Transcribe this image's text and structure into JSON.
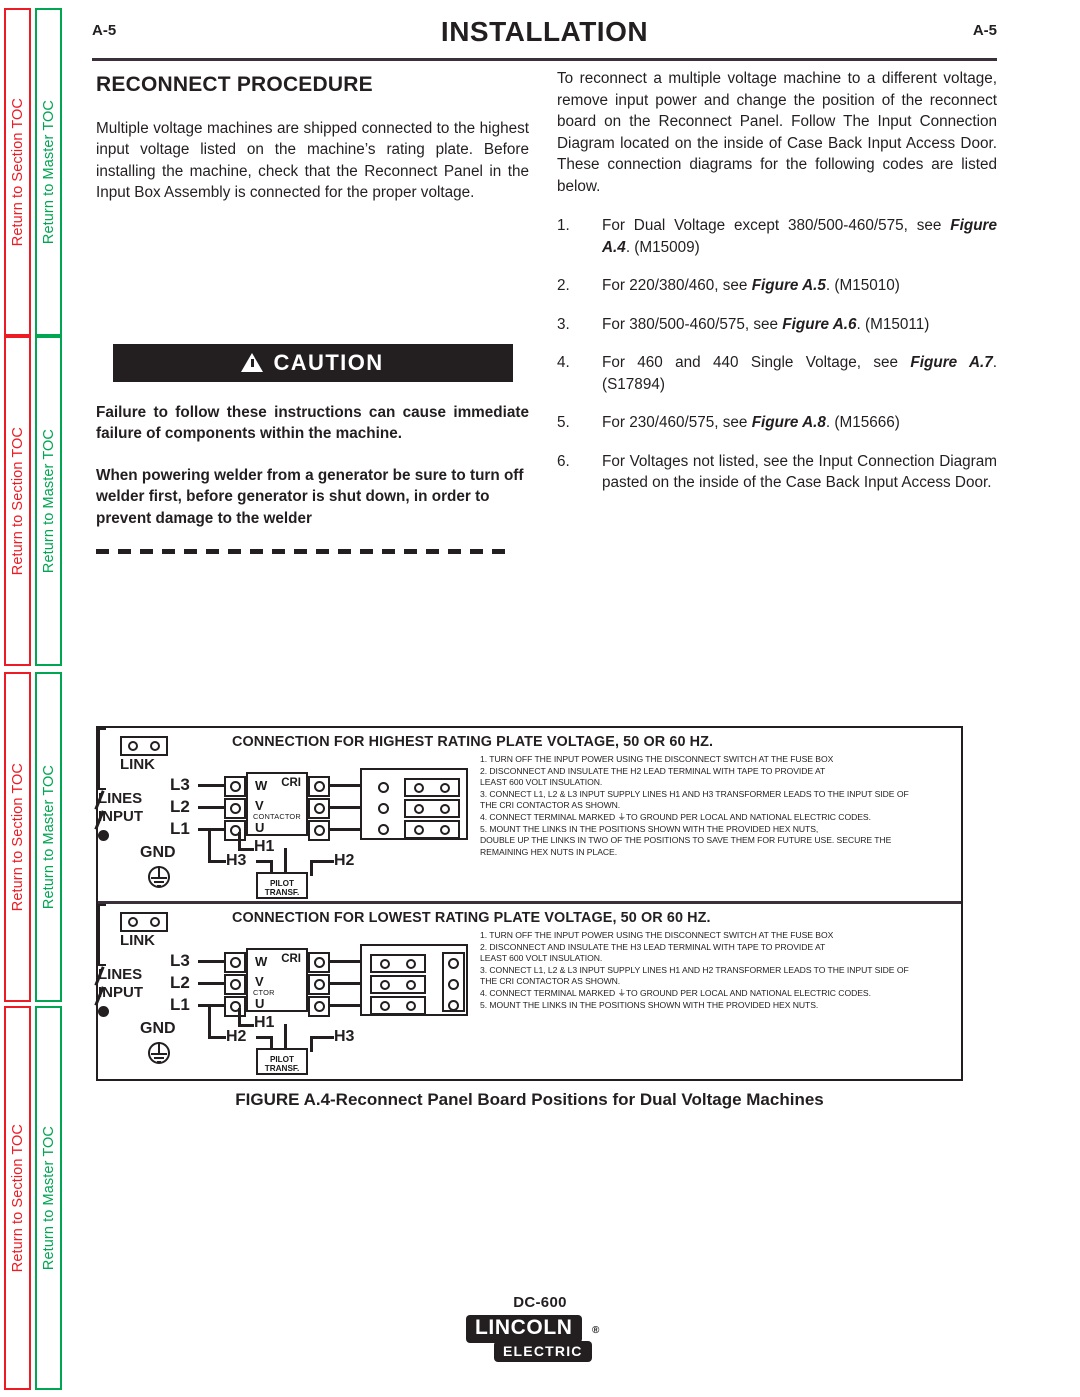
{
  "sidebar": {
    "section_toc_label": "Return to Section TOC",
    "master_toc_label": "Return to Master TOC",
    "section_color": "#ed1c24",
    "master_color": "#00a651",
    "repeat_count": 4
  },
  "header": {
    "page_left": "A-5",
    "page_right": "A-5",
    "section_title": "INSTALLATION"
  },
  "left_column": {
    "heading": "RECONNECT PROCEDURE",
    "intro": "Multiple voltage machines are shipped connected to the highest input voltage listed on the machine’s rating plate. Before installing the machine, check that the Reconnect Panel in the Input Box Assembly is connected for the proper voltage.",
    "caution": {
      "label": "CAUTION",
      "icon": "warning-triangle-icon",
      "paragraph_1": "Failure to follow these instructions can cause immediate failure of components within the machine.",
      "paragraph_2": "When powering welder from a generator be sure to turn off welder first, before generator is shut down, in order to prevent damage to the welder"
    }
  },
  "right_column": {
    "intro": "To reconnect a multiple voltage machine to a different voltage, remove input power and change the position of the reconnect board on the Reconnect Panel. Follow The Input Connection Diagram located on the inside of Case Back Input Access Door.  These connection diagrams for the following codes are listed below.",
    "items": [
      {
        "num": "1.",
        "pre": "For Dual Voltage except 380/500-460/575, see ",
        "fig": "Figure A.4",
        "post": ". (M15009)",
        "fig_bold": false
      },
      {
        "num": "2.",
        "pre": "For 220/380/460, see ",
        "fig": "Figure A.5",
        "post": ". (M15010)",
        "fig_bold": true
      },
      {
        "num": "3.",
        "pre": "For 380/500-460/575, see ",
        "fig": "Figure A.6",
        "post": ". (M15011)",
        "fig_bold": true
      },
      {
        "num": "4.",
        "pre": "For 460 and 440 Single Voltage, see ",
        "fig": "Figure A.7",
        "post": ". (S17894)",
        "fig_bold": true
      },
      {
        "num": "5.",
        "pre": "For 230/460/575, see ",
        "fig": "Figure A.8",
        "post": ". (M15666)",
        "fig_bold": true
      },
      {
        "num": "6.",
        "pre": "For Voltages not listed, see the Input Connection Diagram pasted on the inside of the Case Back Input Access Door.",
        "fig": "",
        "post": "",
        "fig_bold": false
      }
    ]
  },
  "figure": {
    "caption": "FIGURE A.4-Reconnect Panel Board Positions for Dual Voltage Machines",
    "diagram_highest": {
      "title": "CONNECTION FOR HIGHEST RATING PLATE VOLTAGE, 50 OR 60 HZ.",
      "link_label": "LINK",
      "lines_label": "LINES",
      "input_label": "INPUT",
      "gnd_label": "GND",
      "line_labels": [
        "L3",
        "L2",
        "L1"
      ],
      "contactor_phases": [
        "W",
        "V",
        "U"
      ],
      "contactor_name": "CRI",
      "contactor_sub": "CONTACTOR",
      "pilot_label_1": "PILOT",
      "pilot_label_2": "TRANSF.",
      "lead_left": "H3",
      "lead_mid": "H1",
      "lead_right": "H2",
      "board_style": "holes-left-links-right",
      "instructions": [
        "1.  TURN OFF THE INPUT POWER USING THE DISCONNECT SWITCH AT THE FUSE BOX",
        "2.  DISCONNECT AND INSULATE THE H2 LEAD TERMINAL WITH TAPE TO PROVIDE AT",
        "LEAST 600 VOLT INSULATION.",
        "3.  CONNECT  L1, L2  & L3 INPUT SUPPLY LINES H1 AND H3 TRANSFORMER LEADS  TO THE INPUT SIDE OF",
        "THE CRI CONTACTOR AS SHOWN.",
        "4.  CONNECT TERMINAL MARKED ⏚TO GROUND PER LOCAL AND NATIONAL ELECTRIC CODES.",
        "5.  MOUNT THE LINKS IN THE POSITIONS SHOWN WITH THE PROVIDED HEX NUTS,",
        "DOUBLE UP THE LINKS IN TWO OF THE POSITIONS TO SAVE THEM FOR FUTURE USE. SECURE THE",
        "REMAINING HEX NUTS IN PLACE."
      ]
    },
    "diagram_lowest": {
      "title": "CONNECTION FOR LOWEST RATING PLATE VOLTAGE, 50 OR 60 HZ.",
      "link_label": "LINK",
      "lines_label": "LINES",
      "input_label": "INPUT",
      "gnd_label": "GND",
      "line_labels": [
        "L3",
        "L2",
        "L1"
      ],
      "contactor_phases": [
        "W",
        "V",
        "U"
      ],
      "contactor_name": "CRI",
      "contactor_sub": "CTOR",
      "pilot_label_1": "PILOT",
      "pilot_label_2": "TRANSF.",
      "lead_left": "H2",
      "lead_mid": "H1",
      "lead_right": "H3",
      "board_style": "links-left-holes-right",
      "instructions": [
        "1.   TURN OFF THE INPUT POWER USING THE DISCONNECT SWITCH AT THE FUSE BOX",
        "2.  DISCONNECT AND INSULATE THE H3 LEAD TERMINAL WITH TAPE TO PROVIDE AT",
        "LEAST 600 VOLT INSULATION.",
        "3.  CONNECT  L1, L2  & L3 INPUT SUPPLY LINES H1 AND H2 TRANSFORMER LEADS  TO THE INPUT SIDE OF",
        "THE CRI CONTACTOR AS SHOWN.",
        "4.  CONNECT TERMINAL MARKED ⏚TO GROUND PER LOCAL AND NATIONAL ELECTRIC CODES.",
        "5.  MOUNT THE LINKS IN THE POSITIONS SHOWN WITH THE PROVIDED HEX NUTS."
      ]
    }
  },
  "footer": {
    "model": "DC-600",
    "brand_line1": "LINCOLN",
    "brand_reg": "®",
    "brand_line2": "ELECTRIC"
  }
}
